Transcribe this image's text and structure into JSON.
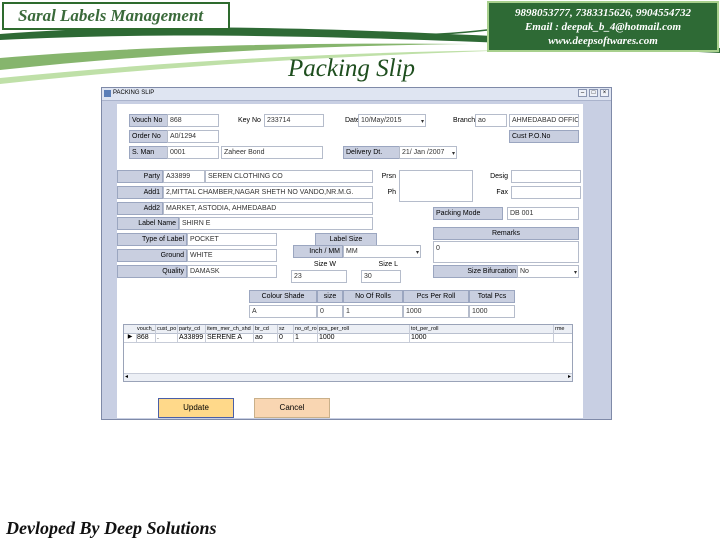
{
  "header": {
    "app_title": "Saral Labels Management",
    "contact": {
      "phones": "9898053777, 7383315626, 9904554732",
      "email": "Email : deepak_b_4@hotmail.com",
      "website": "www.deepsoftwares.com"
    }
  },
  "slide_title": "Packing Slip",
  "footer": "Devloped By Deep Solutions",
  "window": {
    "title": "PACKING SLIP"
  },
  "form": {
    "vouch_no_label": "Vouch No",
    "vouch_no": "868",
    "key_no_label": "Key No",
    "key_no": "233714",
    "date_label": "Date",
    "date": "10/May/2015",
    "branch_label": "Branch",
    "branch_code": "ao",
    "branch_name": "AHMEDABAD OFFICE",
    "order_no_label": "Order No",
    "order_no": "A0/1294",
    "cust_po_label": "Cust P.O.No",
    "cust_po": "",
    "sman_label": "S. Man",
    "sman_code": "0001",
    "sman_name": "Zaheer Bond",
    "delivery_label": "Delivery Dt.",
    "delivery_date": "21/ Jan /2007",
    "party_label": "Party",
    "party_code": "A33899",
    "party_name": "SEREN CLOTHING CO",
    "prsn_label": "Prsn",
    "desig_label": "Desig",
    "add1_label": "Add1",
    "add1": "2,MITTAL CHAMBER,NAGAR SHETH NO VANDO,NR.M.G.",
    "ph_label": "Ph",
    "fax_label": "Fax",
    "add2_label": "Add2",
    "add2": "MARKET, ASTODIA, AHMEDABAD",
    "packing_mode_label": "Packing Mode",
    "packing_mode": "DB 001",
    "label_name_label": "Label Name",
    "label_name": "SHIRN E",
    "remarks_label": "Remarks",
    "type_of_label_label": "Type of Label",
    "type_of_label": "POCKET",
    "label_size_label": "Label Size",
    "inch_mm_label": "Inch / MM",
    "inch_mm": "MM",
    "remarks_value": "0",
    "ground_label": "Ground",
    "ground": "WHITE",
    "quality_label": "Quality",
    "quality": "DAMASK",
    "size_w_label": "Size W",
    "size_w": "23",
    "size_l_label": "Size L",
    "size_l": "30",
    "size_bifurcation_label": "Size Bifurcation",
    "size_bifurcation": "No"
  },
  "shade_table": {
    "headers": [
      "Colour Shade",
      "size",
      "No Of Rolls",
      "Pcs Per Roll",
      "Total Pcs"
    ],
    "values": [
      "A",
      "0",
      "1",
      "1000",
      "1000"
    ]
  },
  "grid": {
    "columns": [
      "vouch_no",
      "cust_po",
      "party_cd",
      "item_mer_ch_shd",
      "br_cd",
      "sz",
      "no_of_rolls",
      "pcs_per_roll",
      "tot_per_roll",
      "rme"
    ],
    "row": [
      "868",
      ".",
      "A33899",
      "SERENE A",
      "ao",
      "0",
      "1",
      "1000",
      "1000",
      ""
    ]
  },
  "buttons": {
    "update": "Update",
    "cancel": "Cancel"
  },
  "colors": {
    "brand_green": "#2e6a35",
    "accent_light_green": "#a8d08d",
    "window_bg": "#c8cfe3",
    "update_btn": "#ffd98a",
    "cancel_btn": "#f9d6b2"
  }
}
